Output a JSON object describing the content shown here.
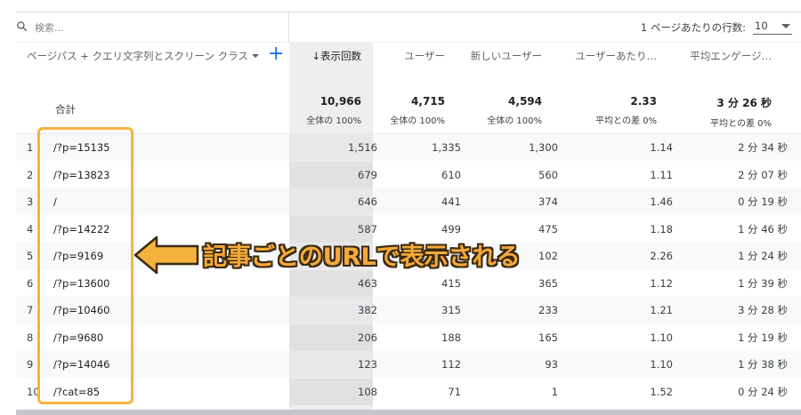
{
  "search": {
    "placeholder": "検索..."
  },
  "rows_per_page": {
    "label": "1 ページあたりの行数:",
    "value": "10"
  },
  "dimension_header": "ページパス + クエリ文字列とスクリーン クラス",
  "metric_headers": [
    "↓表示回数",
    "ユーザー",
    "新しいユーザー",
    "ユーザーあたり…",
    "平均エンゲージ…"
  ],
  "totals": {
    "label": "合計",
    "values": [
      "10,966",
      "4,715",
      "4,594",
      "2.33",
      "3 分 26 秒"
    ],
    "subs": [
      "全体の 100%",
      "全体の 100%",
      "全体の 100%",
      "平均との差 0%",
      "平均との差 0%"
    ]
  },
  "rows": [
    {
      "idx": "1",
      "page": "/?p=15135",
      "views": "1,516",
      "users": "1,335",
      "new_users": "1,300",
      "per_user": "1.14",
      "engagement": "2 分 34 秒"
    },
    {
      "idx": "2",
      "page": "/?p=13823",
      "views": "679",
      "users": "610",
      "new_users": "560",
      "per_user": "1.11",
      "engagement": "2 分 07 秒"
    },
    {
      "idx": "3",
      "page": "/",
      "views": "646",
      "users": "441",
      "new_users": "374",
      "per_user": "1.46",
      "engagement": "0 分 19 秒"
    },
    {
      "idx": "4",
      "page": "/?p=14222",
      "views": "587",
      "users": "499",
      "new_users": "475",
      "per_user": "1.18",
      "engagement": "1 分 46 秒"
    },
    {
      "idx": "5",
      "page": "/?p=9169",
      "views": "",
      "users": "",
      "new_users": "102",
      "per_user": "2.26",
      "engagement": "1 分 24 秒"
    },
    {
      "idx": "6",
      "page": "/?p=13600",
      "views": "463",
      "users": "415",
      "new_users": "365",
      "per_user": "1.12",
      "engagement": "1 分 39 秒"
    },
    {
      "idx": "7",
      "page": "/?p=10460",
      "views": "382",
      "users": "315",
      "new_users": "233",
      "per_user": "1.21",
      "engagement": "3 分 28 秒"
    },
    {
      "idx": "8",
      "page": "/?p=9680",
      "views": "206",
      "users": "188",
      "new_users": "165",
      "per_user": "1.10",
      "engagement": "1 分 19 秒"
    },
    {
      "idx": "9",
      "page": "/?p=14046",
      "views": "123",
      "users": "112",
      "new_users": "93",
      "per_user": "1.10",
      "engagement": "1 分 38 秒"
    },
    {
      "idx": "10",
      "page": "/?cat=85",
      "views": "108",
      "users": "71",
      "new_users": "1",
      "per_user": "1.52",
      "engagement": "0 分 24 秒"
    }
  ],
  "annotation": {
    "text": "記事ごとのURLで表示される",
    "color": "#f4a93a"
  },
  "colors": {
    "accent": "#1a73e8",
    "highlight": "#f5b33d"
  }
}
